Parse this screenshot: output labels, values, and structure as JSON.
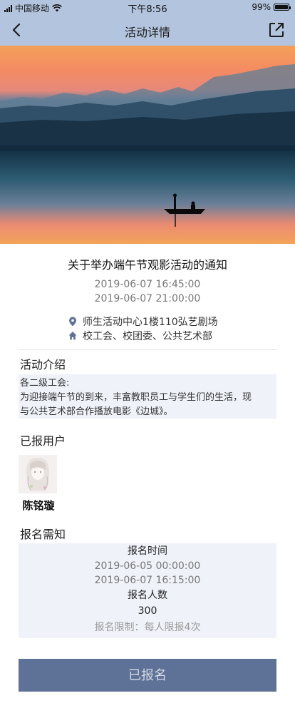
{
  "status_bar": {
    "carrier": "中国移动",
    "time": "下午8:56",
    "battery_percent": "99%",
    "battery_level": 0.99,
    "icons": [
      "signal-icon",
      "wifi-icon",
      "battery-icon"
    ]
  },
  "nav": {
    "title": "活动详情",
    "back_icon": "chevron-left-icon",
    "share_icon": "share-icon"
  },
  "event": {
    "title": "关于举办端午节观影活动的通知",
    "start_time": "2019-06-07 16:45:00",
    "end_time": "2019-06-07 21:00:00",
    "location": "师生活动中心1楼110弘艺剧场",
    "organizers": "校工会、校团委、公共艺术部"
  },
  "intro": {
    "title": "活动介绍",
    "line1": "各二级工会:",
    "line2": "为迎接端午节的到来，丰富教职员工与学生们的生活，现",
    "line3": "与公共艺术部合作播放电影《边城》。"
  },
  "registered_users": {
    "title": "已报用户",
    "users": [
      {
        "name": "陈铭璇"
      }
    ]
  },
  "notice": {
    "title": "报名需知",
    "time_label": "报名时间",
    "time_start": "2019-06-05 00:00:00",
    "time_end": "2019-06-07 16:15:00",
    "count_label": "报名人数",
    "count_value": "300",
    "limit": "报名限制：每人限报4次"
  },
  "action": {
    "button_label": "已报名"
  },
  "colors": {
    "nav_background": "#b3c4de",
    "button_background": "#5e7196",
    "info_box_background": "#eff2f9"
  }
}
